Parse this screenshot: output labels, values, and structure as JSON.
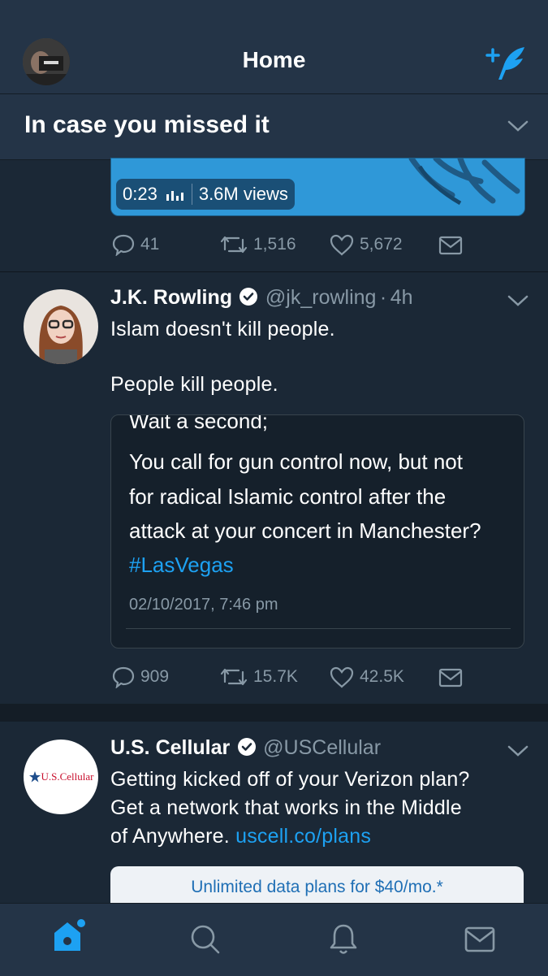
{
  "header": {
    "title": "Home",
    "compose_icon": "compose-tweet-icon"
  },
  "banner": {
    "label": "In case you missed it"
  },
  "video": {
    "duration": "0:23",
    "views": "3.6M views"
  },
  "tweet0_actions": {
    "replies": "41",
    "retweets": "1,516",
    "likes": "5,672"
  },
  "tweet1": {
    "name": "J.K. Rowling",
    "handle": "@jk_rowling",
    "sep": "·",
    "time": "4h",
    "text_line1": "Islam doesn't kill people.",
    "text_line2": "People kill people.",
    "quote": {
      "cut_line": "Wait a second;",
      "line1": "You call for gun control now, but not",
      "line2": "for radical Islamic control after the",
      "line3": "attack at your concert in Manchester?",
      "hashtag": "#LasVegas",
      "timestamp": "02/10/2017, 7:46 pm"
    },
    "actions": {
      "replies": "909",
      "retweets": "15.7K",
      "likes": "42.5K"
    }
  },
  "tweet2": {
    "name": "U.S. Cellular",
    "handle": "@USCellular",
    "text_line1": "Getting kicked off of your Verizon plan?",
    "text_line2": "Get a network that works in the Middle",
    "text_line3_prefix": "of Anywhere.",
    "link": "uscell.co/plans",
    "avatar_logo": "U.S.Cellular",
    "ad_text": "Unlimited data plans for $40/mo.*"
  },
  "tabs": [
    "home-tab",
    "search-tab",
    "notifications-tab",
    "messages-tab"
  ],
  "colors": {
    "background": "#1b2836",
    "bar": "#243447",
    "accent": "#1da1f2",
    "muted": "#8899a6"
  }
}
